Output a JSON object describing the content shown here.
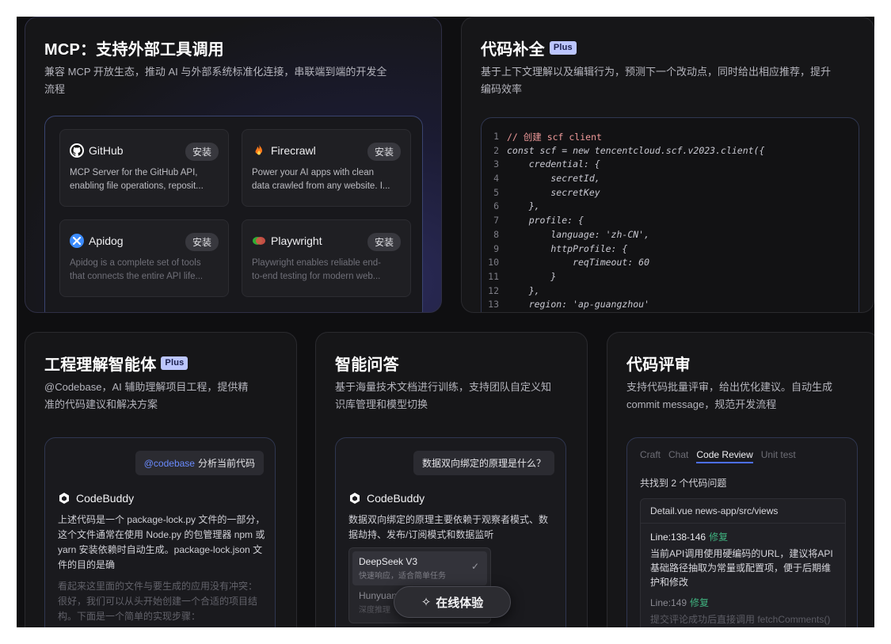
{
  "mcp": {
    "title": "MCP：支持外部工具调用",
    "desc_line1": "兼容 MCP 开放生态，推动 AI 与外部系统标准化连接，串联端到端的开发全",
    "desc_line2": "流程",
    "install_label": "安装",
    "tools": [
      {
        "name": "GitHub",
        "desc1": "MCP Server for the GitHub API,",
        "desc2": "enabling file operations, reposit..."
      },
      {
        "name": "Firecrawl",
        "desc1": "Power your AI apps with clean",
        "desc2": "data crawled from any website. I..."
      },
      {
        "name": "Apidog",
        "desc1": "Apidog is a complete set of tools",
        "desc2": "that connects the entire API life..."
      },
      {
        "name": "Playwright",
        "desc1": "Playwright enables reliable end-",
        "desc2": "to-end testing for modern web..."
      }
    ]
  },
  "code": {
    "title": "代码补全",
    "badge": "Plus",
    "desc_line1": "基于上下文理解以及编辑行为，预测下一个改动点，同时给出相应推荐，提升",
    "desc_line2": "编码效率",
    "lines": [
      {
        "n": "1",
        "t": "// 创建 scf client"
      },
      {
        "n": "2",
        "t": "const scf = new tencentcloud.scf.v2023.client({"
      },
      {
        "n": "3",
        "t": "    credential: {"
      },
      {
        "n": "4",
        "t": "        secretId,"
      },
      {
        "n": "5",
        "t": "        secretKey"
      },
      {
        "n": "6",
        "t": "    },"
      },
      {
        "n": "7",
        "t": "    profile: {"
      },
      {
        "n": "8",
        "t": "        language: 'zh-CN',"
      },
      {
        "n": "9",
        "t": "        httpProfile: {"
      },
      {
        "n": "10",
        "t": "            reqTimeout: 60"
      },
      {
        "n": "11",
        "t": "        }"
      },
      {
        "n": "12",
        "t": "    },"
      },
      {
        "n": "13",
        "t": "    region: 'ap-guangzhou'"
      }
    ]
  },
  "agent": {
    "title": "工程理解智能体",
    "badge": "Plus",
    "desc_line1": "@Codebase，AI 辅助理解项目工程，提供精",
    "desc_line2": "准的代码建议和解决方案",
    "mention": "@codebase",
    "user_msg": "分析当前代码",
    "bot_name": "CodeBuddy",
    "reply1": "上述代码是一个 package-lock.py 文件的一部分，这个文件通常在使用 Node.py 的包管理器 npm 或 yarn 安装依赖时自动生成。package-lock.json 文件的目的是确",
    "reply2": "看起来这里面的文件与要生成的应用没有冲突：很好，我们可以从头开始创建一个合适的项目结构。下面是一个简单的实现步骤："
  },
  "qa": {
    "title": "智能问答",
    "desc_line1": "基于海量技术文档进行训练，支持团队自定义知",
    "desc_line2": "识库管理和模型切换",
    "user_msg": "数据双向绑定的原理是什么？",
    "bot_name": "CodeBuddy",
    "reply": "数据双向绑定的原理主要依赖于观察者模式、数据劫持、发布/订阅模式和数据监听",
    "models": [
      {
        "name": "DeepSeek V3",
        "sub": "快速响应，适合简单任务"
      },
      {
        "name": "Hunyuan",
        "sub": "深度推理"
      }
    ]
  },
  "review": {
    "title": "代码评审",
    "desc_line1": "支持代码批量评审，给出优化建议。自动生成",
    "desc_line2": "commit message，规范开发流程",
    "tabs": [
      "Craft",
      "Chat",
      "Code Review",
      "Unit test"
    ],
    "found": "共找到 2 个代码问题",
    "file": "Detail.vue  news-app/src/views",
    "issue1_line": "Line:138-146",
    "fix_label": "修复",
    "issue1_text": "当前API调用使用硬编码的URL，建议将API基础路径抽取为常量或配置项，便于后期维护和修改",
    "issue2_line": "Line:149",
    "issue2_text": "提交评论成功后直接调用 fetchComments()"
  },
  "try_button": "在线体验",
  "colors": {
    "accent": "#4c6fff",
    "badge_bg": "#bcc6ff",
    "fix_green": "#3fb27f",
    "mention_blue": "#6a8bff"
  }
}
